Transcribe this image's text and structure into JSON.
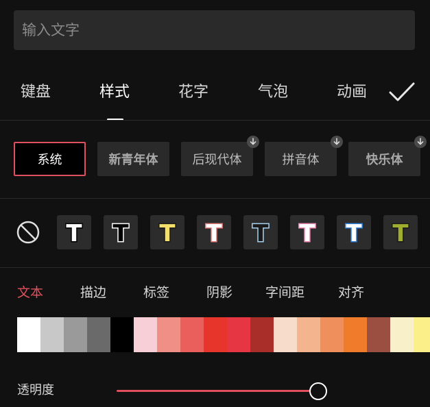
{
  "input": {
    "placeholder": "输入文字"
  },
  "tabs": [
    {
      "label": "键盘"
    },
    {
      "label": "样式"
    },
    {
      "label": "花字"
    },
    {
      "label": "气泡"
    },
    {
      "label": "动画"
    }
  ],
  "active_tab": "样式",
  "confirm_icon": "checkmark-icon",
  "fonts": [
    {
      "label": "系统",
      "selected": true,
      "downloadable": false
    },
    {
      "label": "新青年体",
      "selected": false,
      "downloadable": false
    },
    {
      "label": "后现代体",
      "selected": false,
      "downloadable": true
    },
    {
      "label": "拼音体",
      "selected": false,
      "downloadable": true
    },
    {
      "label": "快乐体",
      "selected": false,
      "downloadable": true
    }
  ],
  "presets": {
    "none_icon": "no-style-icon",
    "items": [
      {
        "letter": "T",
        "fill": "#ffffff",
        "stroke": "#000000"
      },
      {
        "letter": "T",
        "fill": "#000000",
        "stroke": "#ffffff"
      },
      {
        "letter": "T",
        "fill": "#f3df6a",
        "stroke": "#1a1a1a"
      },
      {
        "letter": "T",
        "fill": "#ffffff",
        "stroke": "#e37b7b"
      },
      {
        "letter": "T",
        "fill": "#1a1a1a",
        "stroke": "#a9d2ee"
      },
      {
        "letter": "T",
        "fill": "#ffffff",
        "stroke": "#ef86b3"
      },
      {
        "letter": "T",
        "fill": "#ffffff",
        "stroke": "#2f7fdc"
      },
      {
        "letter": "T",
        "fill": "#9fae2e",
        "stroke": "#1a1a1a"
      }
    ]
  },
  "subtabs": [
    {
      "label": "文本"
    },
    {
      "label": "描边"
    },
    {
      "label": "标签"
    },
    {
      "label": "阴影"
    },
    {
      "label": "字间距"
    },
    {
      "label": "对齐"
    }
  ],
  "active_subtab": "文本",
  "swatches": [
    "#ffffff",
    "#c8c8c8",
    "#9a9a9a",
    "#6a6a6a",
    "#000000",
    "#f7cfd6",
    "#ef8f86",
    "#ea5e5c",
    "#e8352c",
    "#e63543",
    "#a92d29",
    "#f8dccb",
    "#f4b48d",
    "#ef8f5c",
    "#ef7b2b",
    "#9a4f40",
    "#f8f0c8",
    "#fbef8a"
  ],
  "opacity": {
    "label": "透明度",
    "value": 1.0
  },
  "colors": {
    "accent": "#e0505d",
    "background": "#111111",
    "panel": "#2a2a2a"
  }
}
